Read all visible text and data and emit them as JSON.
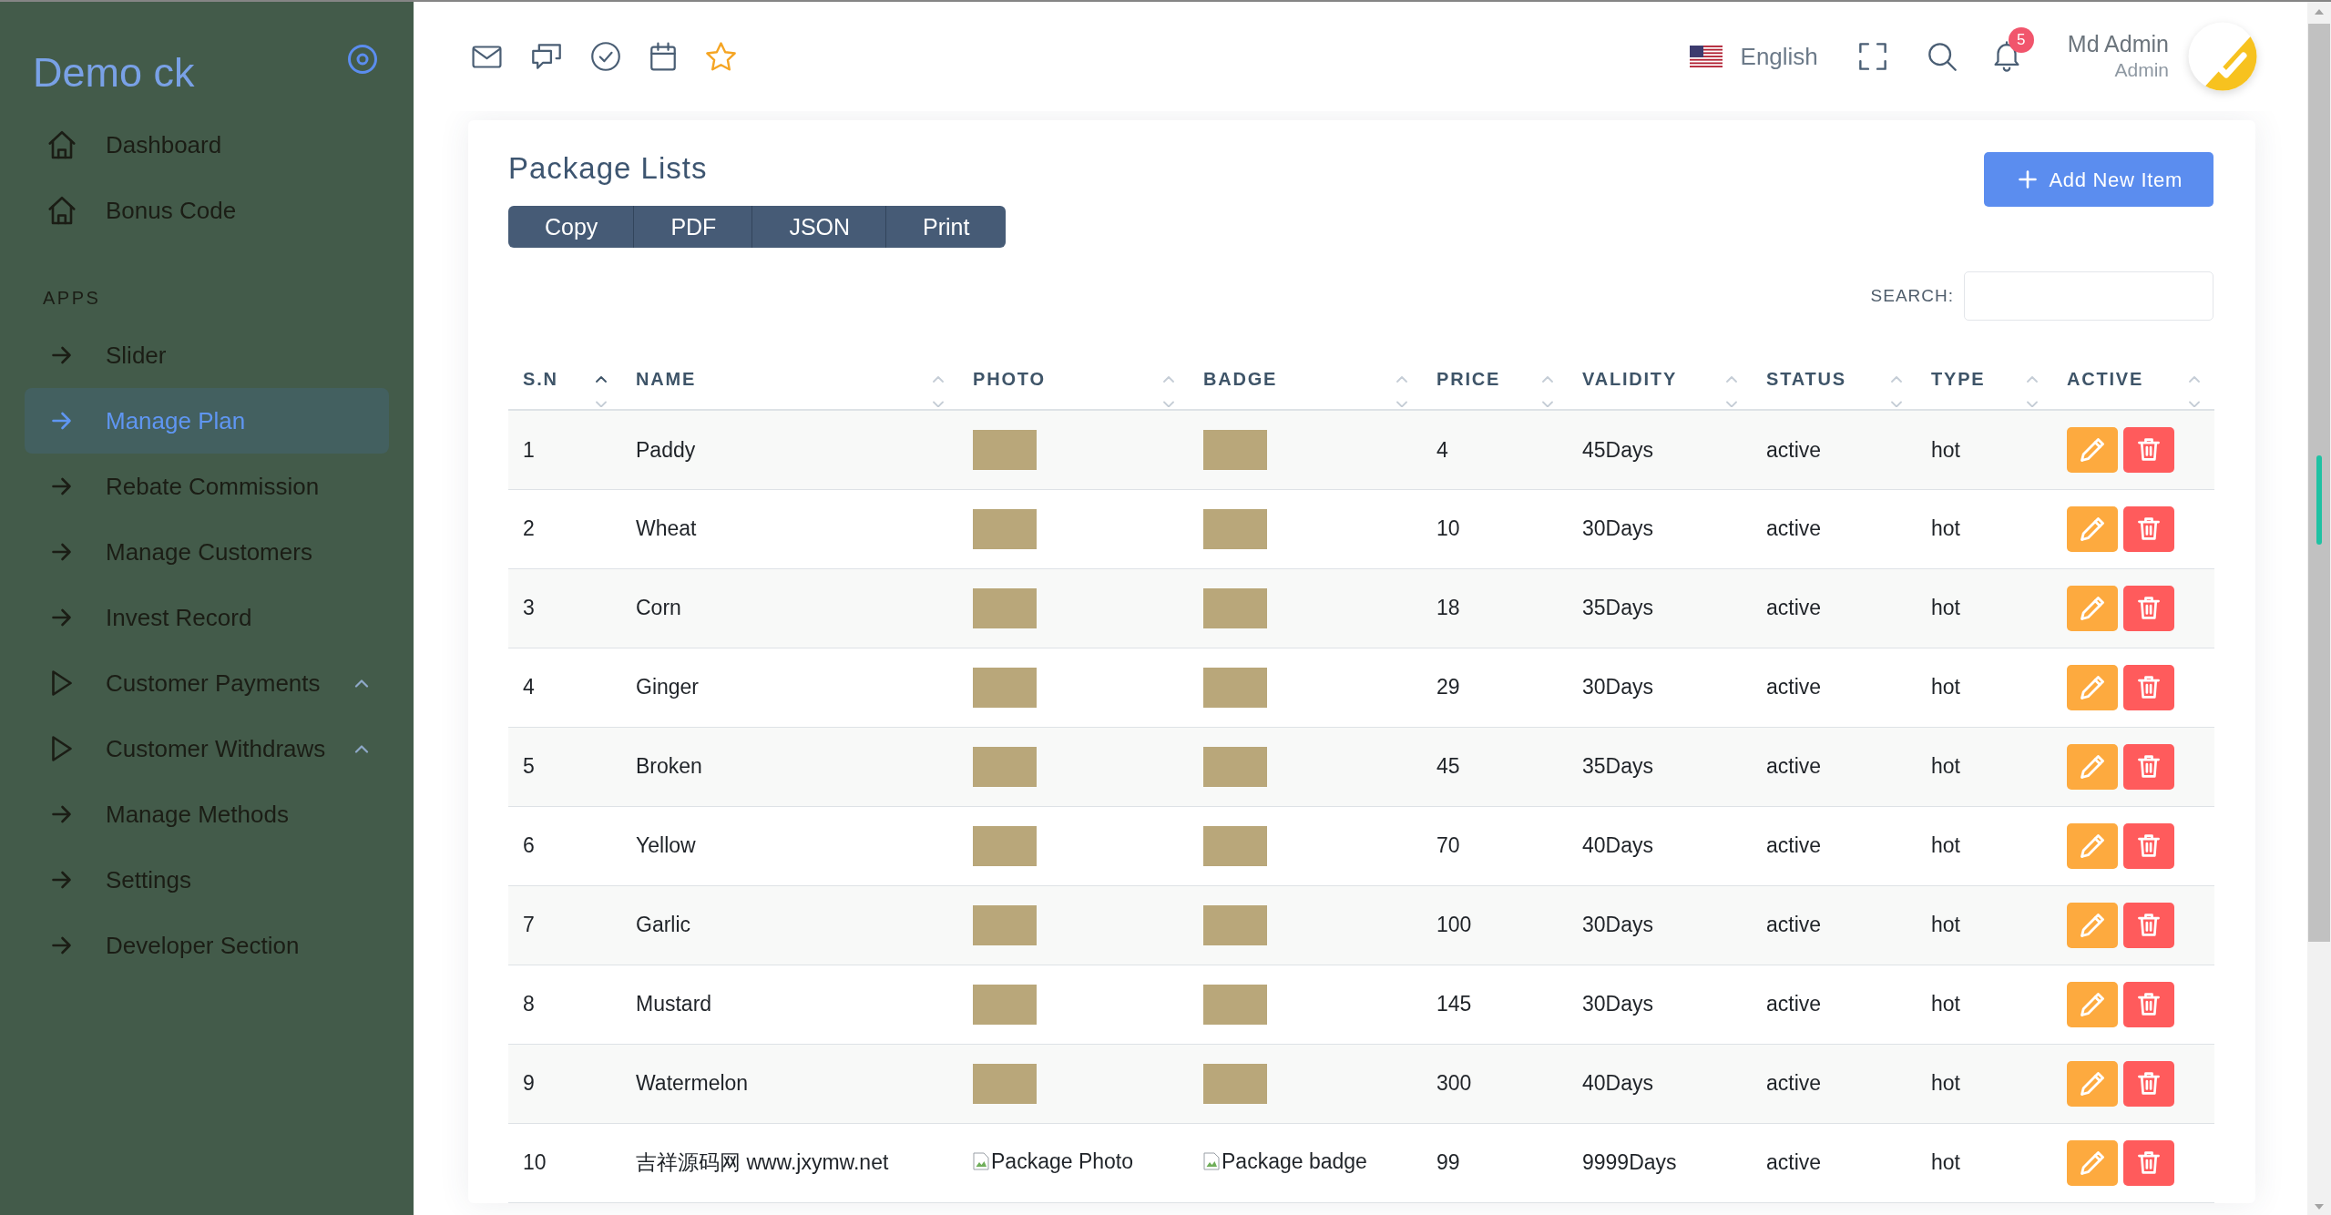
{
  "sidebar": {
    "logo": "Demo ck",
    "sections": [
      {
        "items": [
          {
            "label": "Dashboard",
            "kind": "home",
            "selected": false
          },
          {
            "label": "Bonus Code",
            "kind": "home",
            "selected": false
          }
        ]
      },
      {
        "title": "APPS",
        "items": [
          {
            "label": "Slider",
            "kind": "link",
            "selected": false
          },
          {
            "label": "Manage Plan",
            "kind": "link",
            "selected": true
          },
          {
            "label": "Rebate Commission",
            "kind": "link",
            "selected": false
          },
          {
            "label": "Manage Customers",
            "kind": "link",
            "selected": false
          },
          {
            "label": "Invest Record",
            "kind": "link",
            "selected": false
          },
          {
            "label": "Customer Payments",
            "kind": "group",
            "selected": false
          },
          {
            "label": "Customer Withdraws",
            "kind": "group",
            "selected": false
          },
          {
            "label": "Manage Methods",
            "kind": "link",
            "selected": false
          },
          {
            "label": "Settings",
            "kind": "link",
            "selected": false
          },
          {
            "label": "Developer Section",
            "kind": "link",
            "selected": false
          }
        ]
      }
    ]
  },
  "top_bar": {
    "language": "English",
    "notification_count": "5",
    "user": {
      "name": "Md Admin",
      "role": "Admin"
    }
  },
  "card": {
    "title": "Package Lists",
    "export_buttons": [
      "Copy",
      "PDF",
      "JSON",
      "Print"
    ],
    "add_button": "Add New Item",
    "search": {
      "label": "SEARCH:"
    }
  },
  "table": {
    "columns": [
      {
        "label": "S.N",
        "sorted": true
      },
      {
        "label": "NAME",
        "sorted": false
      },
      {
        "label": "PHOTO",
        "sorted": false
      },
      {
        "label": "BADGE",
        "sorted": false
      },
      {
        "label": "PRICE",
        "sorted": false
      },
      {
        "label": "VALIDITY",
        "sorted": false
      },
      {
        "label": "STATUS",
        "sorted": false
      },
      {
        "label": "TYPE",
        "sorted": false
      },
      {
        "label": "ACTIVE",
        "sorted": false
      }
    ],
    "rows": [
      {
        "sn": "1",
        "name": "Paddy",
        "photo": {
          "kind": "image"
        },
        "badge": {
          "kind": "image"
        },
        "price": "4",
        "validity": "45Days",
        "status": "active",
        "type": "hot"
      },
      {
        "sn": "2",
        "name": "Wheat",
        "photo": {
          "kind": "image"
        },
        "badge": {
          "kind": "image"
        },
        "price": "10",
        "validity": "30Days",
        "status": "active",
        "type": "hot"
      },
      {
        "sn": "3",
        "name": "Corn",
        "photo": {
          "kind": "image"
        },
        "badge": {
          "kind": "image"
        },
        "price": "18",
        "validity": "35Days",
        "status": "active",
        "type": "hot"
      },
      {
        "sn": "4",
        "name": "Ginger",
        "photo": {
          "kind": "image"
        },
        "badge": {
          "kind": "image"
        },
        "price": "29",
        "validity": "30Days",
        "status": "active",
        "type": "hot"
      },
      {
        "sn": "5",
        "name": "Broken",
        "photo": {
          "kind": "image"
        },
        "badge": {
          "kind": "image"
        },
        "price": "45",
        "validity": "35Days",
        "status": "active",
        "type": "hot"
      },
      {
        "sn": "6",
        "name": "Yellow",
        "photo": {
          "kind": "image"
        },
        "badge": {
          "kind": "image"
        },
        "price": "70",
        "validity": "40Days",
        "status": "active",
        "type": "hot"
      },
      {
        "sn": "7",
        "name": "Garlic",
        "photo": {
          "kind": "image"
        },
        "badge": {
          "kind": "image"
        },
        "price": "100",
        "validity": "30Days",
        "status": "active",
        "type": "hot"
      },
      {
        "sn": "8",
        "name": "Mustard",
        "photo": {
          "kind": "image"
        },
        "badge": {
          "kind": "image"
        },
        "price": "145",
        "validity": "30Days",
        "status": "active",
        "type": "hot"
      },
      {
        "sn": "9",
        "name": "Watermelon",
        "photo": {
          "kind": "image"
        },
        "badge": {
          "kind": "image"
        },
        "price": "300",
        "validity": "40Days",
        "status": "active",
        "type": "hot"
      },
      {
        "sn": "10",
        "name": "吉祥源码网 www.jxymw.net",
        "photo": {
          "kind": "broken",
          "alt": "Package Photo"
        },
        "badge": {
          "kind": "broken",
          "alt": "Package badge"
        },
        "price": "99",
        "validity": "9999Days",
        "status": "active",
        "type": "hot"
      }
    ]
  }
}
